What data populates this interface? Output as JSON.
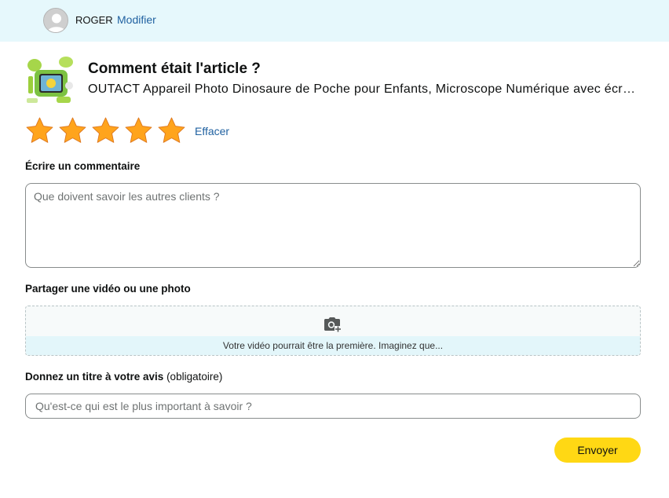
{
  "header": {
    "username": "ROGER",
    "modify_label": "Modifier"
  },
  "product": {
    "heading": "Comment était l'article ?",
    "name": "OUTACT Appareil Photo Dinosaure de Poche pour Enfants, Microscope Numérique avec écran L…",
    "thumbnail_icon": "product-image"
  },
  "rating": {
    "value": 5,
    "max": 5,
    "star_color": "#ffa41c",
    "clear_label": "Effacer"
  },
  "comment": {
    "label": "Écrire un commentaire",
    "placeholder": "Que doivent savoir les autres clients ?",
    "value": ""
  },
  "media": {
    "label": "Partager une vidéo ou une photo",
    "icon": "camera-plus-icon",
    "hint": "Votre vidéo pourrait être la première. Imaginez que..."
  },
  "title_field": {
    "label": "Donnez un titre à votre avis",
    "label_suffix": "(obligatoire)",
    "placeholder": "Qu'est-ce qui est le plus important à savoir ?",
    "value": ""
  },
  "submit": {
    "label": "Envoyer",
    "color": "#ffd814"
  }
}
